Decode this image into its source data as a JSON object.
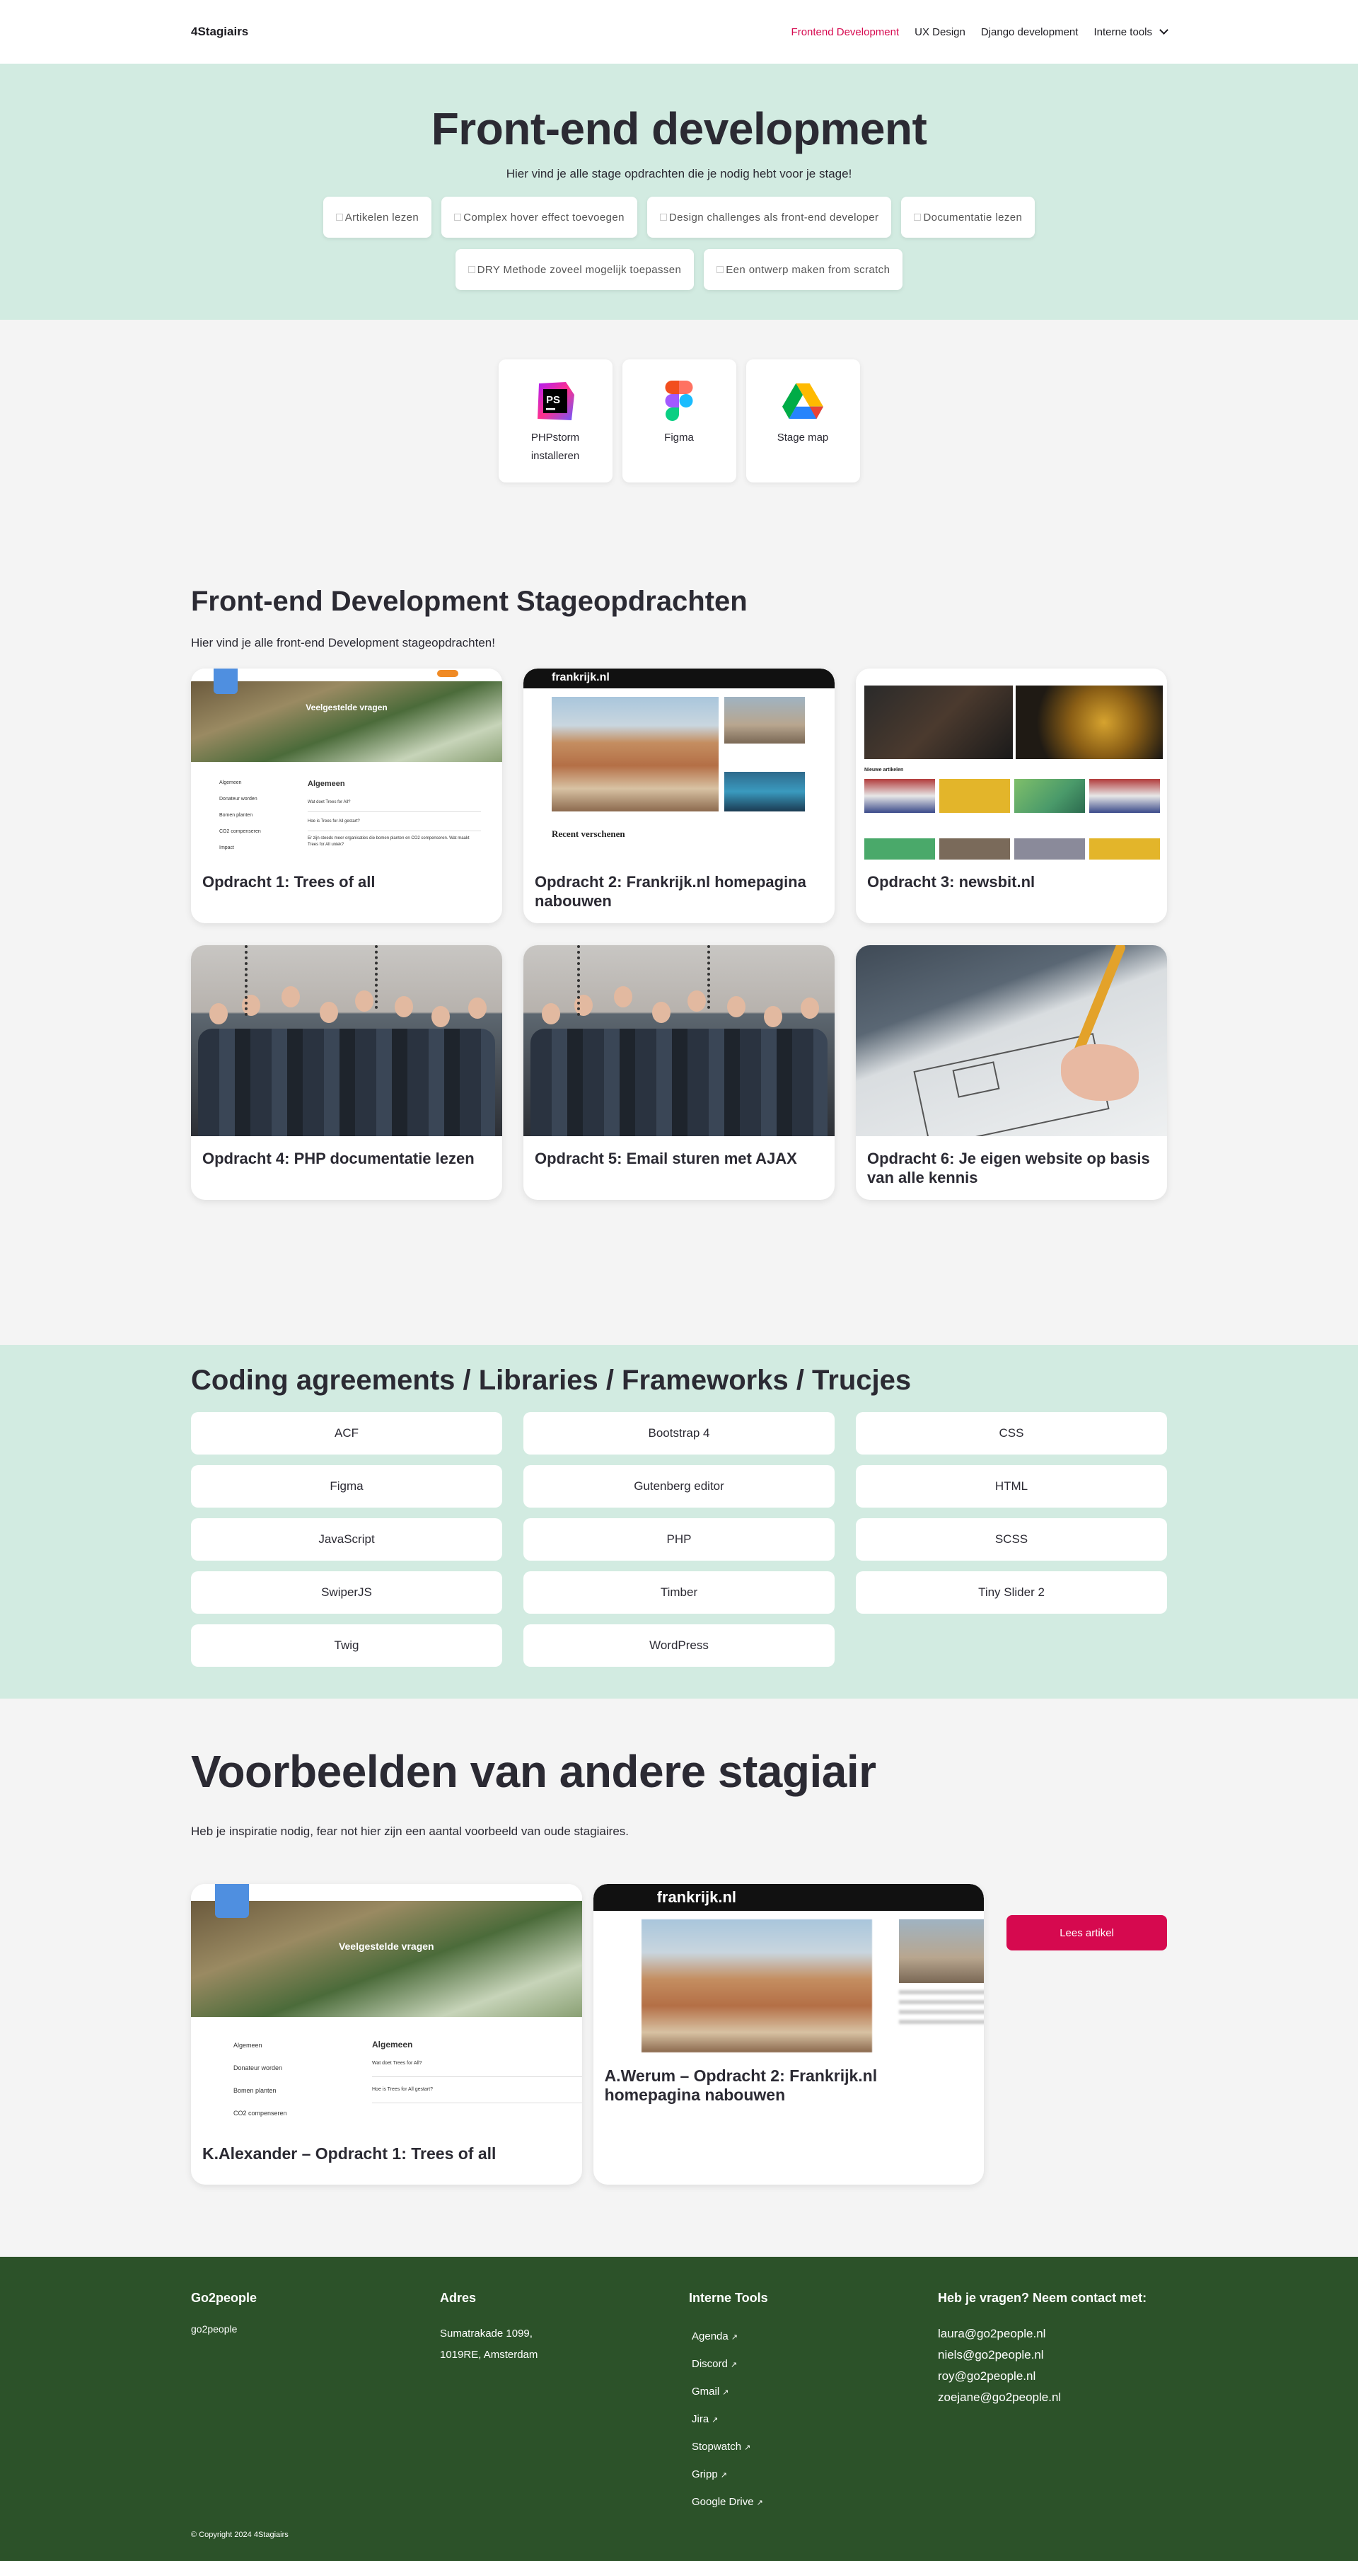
{
  "header": {
    "logo": "4Stagiairs",
    "nav": [
      {
        "label": "Frontend Development",
        "active": true
      },
      {
        "label": "UX Design"
      },
      {
        "label": "Django development"
      },
      {
        "label": "Interne tools",
        "dropdown": true
      }
    ]
  },
  "hero": {
    "title": "Front-end development",
    "subtitle": "Hier vind je alle stage opdrachten die je nodig hebt voor je stage!",
    "pills_row1": [
      "Artikelen lezen",
      "Complex hover effect toevoegen",
      "Design challenges als front-end developer",
      "Documentatie lezen"
    ],
    "pills_row2": [
      "DRY Methode zoveel mogelijk toepassen",
      "Een ontwerp maken from scratch"
    ]
  },
  "tools": [
    {
      "label": "PHPstorm installeren",
      "icon": "phpstorm-icon"
    },
    {
      "label": "Figma",
      "icon": "figma-icon"
    },
    {
      "label": "Stage map",
      "icon": "google-drive-icon"
    }
  ],
  "assignments": {
    "title": "Front-end Development Stageopdrachten",
    "subtitle": "Hier vind je alle front-end Development stageopdrachten!",
    "cards": [
      {
        "title": "Opdracht 1: Trees of all"
      },
      {
        "title": "Opdracht 2: Frankrijk.nl homepagina nabouwen"
      },
      {
        "title": "Opdracht 3: newsbit.nl"
      },
      {
        "title": "Opdracht 4: PHP documentatie lezen"
      },
      {
        "title": "Opdracht 5: Email sturen met AJAX"
      },
      {
        "title": "Opdracht 6: Je eigen website op basis van alle kennis"
      }
    ]
  },
  "thumbs": {
    "trees_heading": "Veelgestelde vragen",
    "trees_faq_title": "Algemeen",
    "trees_faq": [
      "Wat doet Trees for All?",
      "Hoe is Trees for All gestart?",
      "Er zijn steeds meer organisaties die bomen planten en CO2 compenseren. Wat maakt Trees for All uniek?"
    ],
    "trees_menu": [
      "Algemeen",
      "Donateur worden",
      "Bomen planten",
      "CO2 compenseren",
      "Impact"
    ],
    "frankrijk_logo": "frankrijk.nl",
    "frankrijk_recent": "Recent verschenen",
    "newsbit_label": "Nieuwe artikelen"
  },
  "coding": {
    "title": "Coding agreements / Libraries / Frameworks / Trucjes",
    "items": [
      "ACF",
      "Bootstrap 4",
      "CSS",
      "Figma",
      "Gutenberg editor",
      "HTML",
      "JavaScript",
      "PHP",
      "SCSS",
      "SwiperJS",
      "Timber",
      "Tiny Slider 2",
      "Twig",
      "WordPress"
    ]
  },
  "examples": {
    "title": "Voorbeelden van andere stagiair",
    "subtitle": "Heb je inspiratie nodig, fear not hier zijn een aantal voorbeeld van oude stagiaires.",
    "cards": [
      {
        "title": "K.Alexander – Opdracht 1: Trees of all"
      },
      {
        "title": "A.Werum – Opdracht 2: Frankrijk.nl homepagina nabouwen",
        "button": "Lees artikel"
      }
    ]
  },
  "footer": {
    "col1": {
      "heading": "Go2people",
      "brand": "go2people"
    },
    "col2": {
      "heading": "Adres",
      "line1": "Sumatrakade 1099,",
      "line2": "1019RE, Amsterdam"
    },
    "col3": {
      "heading": "Interne Tools",
      "links": [
        "Agenda",
        "Discord",
        "Gmail",
        "Jira",
        "Stopwatch",
        "Gripp",
        "Google Drive"
      ]
    },
    "col4": {
      "heading": "Heb je vragen? Neem contact met:",
      "emails": [
        "laura@go2people.nl",
        "niels@go2people.nl",
        "roy@go2people.nl",
        "zoejane@go2people.nl"
      ]
    },
    "copyright": "© Copyright 2024 4Stagiairs"
  },
  "colors": {
    "accent": "#d6094f",
    "mint": "#d2ebe1",
    "footer": "#2c5229"
  }
}
